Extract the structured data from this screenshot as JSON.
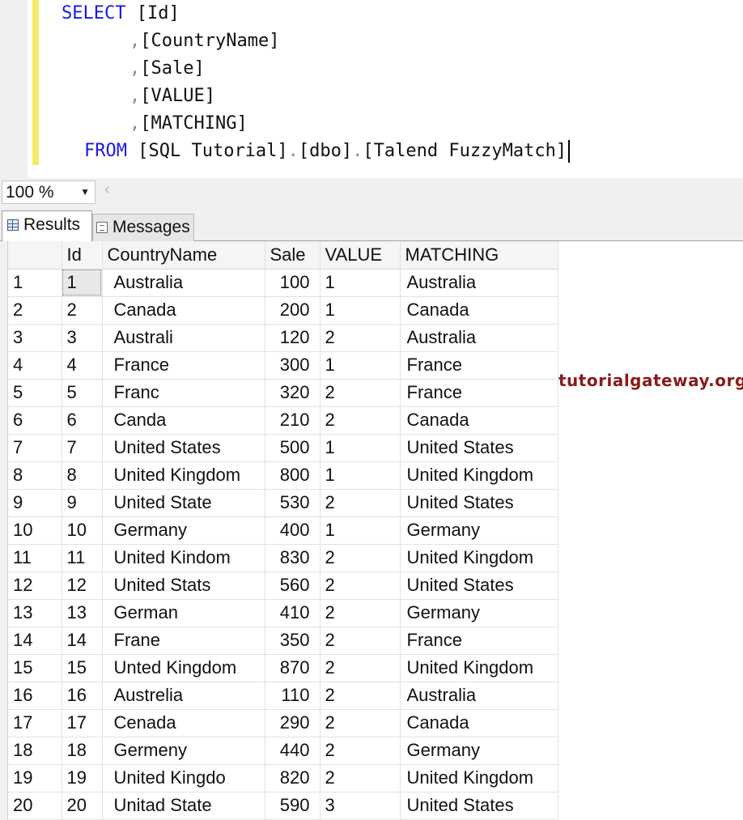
{
  "editor": {
    "lines": [
      {
        "indent": "",
        "keyword": "SELECT",
        "text": " [Id]"
      },
      {
        "indent": "      ",
        "prefix": ",",
        "text": "[CountryName]"
      },
      {
        "indent": "      ",
        "prefix": ",",
        "text": "[Sale]"
      },
      {
        "indent": "      ",
        "prefix": ",",
        "text": "[VALUE]"
      },
      {
        "indent": "      ",
        "prefix": ",",
        "text": "[MATCHING]"
      },
      {
        "indent": "  ",
        "keyword": "FROM",
        "text": " [SQL Tutorial].[dbo].[Talend FuzzyMatch]"
      }
    ],
    "select_keyword": "SELECT",
    "from_keyword": "FROM",
    "col_id": "[Id]",
    "col_country": "[CountryName]",
    "col_sale": "[Sale]",
    "col_value": "[VALUE]",
    "col_matching": "[MATCHING]",
    "from_db": "[SQL Tutorial]",
    "from_schema": "[dbo]",
    "from_table": "[Talend FuzzyMatch]",
    "comma": ",",
    "dot": "."
  },
  "zoom": {
    "value": "100 %"
  },
  "tabs": {
    "results_label": "Results",
    "messages_label": "Messages"
  },
  "grid": {
    "columns": [
      "Id",
      "CountryName",
      "Sale",
      "VALUE",
      "MATCHING"
    ],
    "rows": [
      [
        "1",
        "1",
        "Australia",
        "100",
        "1",
        "Australia"
      ],
      [
        "2",
        "2",
        "Canada",
        "200",
        "1",
        "Canada"
      ],
      [
        "3",
        "3",
        "Australi",
        "120",
        "2",
        "Australia"
      ],
      [
        "4",
        "4",
        "France",
        "300",
        "1",
        "France"
      ],
      [
        "5",
        "5",
        "Franc",
        "320",
        "2",
        "France"
      ],
      [
        "6",
        "6",
        "Canda",
        "210",
        "2",
        "Canada"
      ],
      [
        "7",
        "7",
        "United States",
        "500",
        "1",
        "United States"
      ],
      [
        "8",
        "8",
        "United Kingdom",
        "800",
        "1",
        "United Kingdom"
      ],
      [
        "9",
        "9",
        "United State",
        "530",
        "2",
        "United States"
      ],
      [
        "10",
        "10",
        "Germany",
        "400",
        "1",
        "Germany"
      ],
      [
        "11",
        "11",
        "United Kindom",
        "830",
        "2",
        "United Kingdom"
      ],
      [
        "12",
        "12",
        "United Stats",
        "560",
        "2",
        "United States"
      ],
      [
        "13",
        "13",
        "German",
        "410",
        "2",
        "Germany"
      ],
      [
        "14",
        "14",
        "Frane",
        "350",
        "2",
        "France"
      ],
      [
        "15",
        "15",
        "Unted Kingdom",
        "870",
        "2",
        "United Kingdom"
      ],
      [
        "16",
        "16",
        "Austrelia",
        "110",
        "2",
        "Australia"
      ],
      [
        "17",
        "17",
        "Cenada",
        "290",
        "2",
        "Canada"
      ],
      [
        "18",
        "18",
        "Germeny",
        "440",
        "2",
        "Germany"
      ],
      [
        "19",
        "19",
        "United Kingdo",
        "820",
        "2",
        "United Kingdom"
      ],
      [
        "20",
        "20",
        "Unitad State",
        "590",
        "3",
        "United States"
      ]
    ]
  },
  "watermark": "tutorialgateway.org",
  "colors": {
    "keyword": "#1a1ae6",
    "change_bar": "#f5ea66",
    "watermark": "#8b1a1a"
  }
}
